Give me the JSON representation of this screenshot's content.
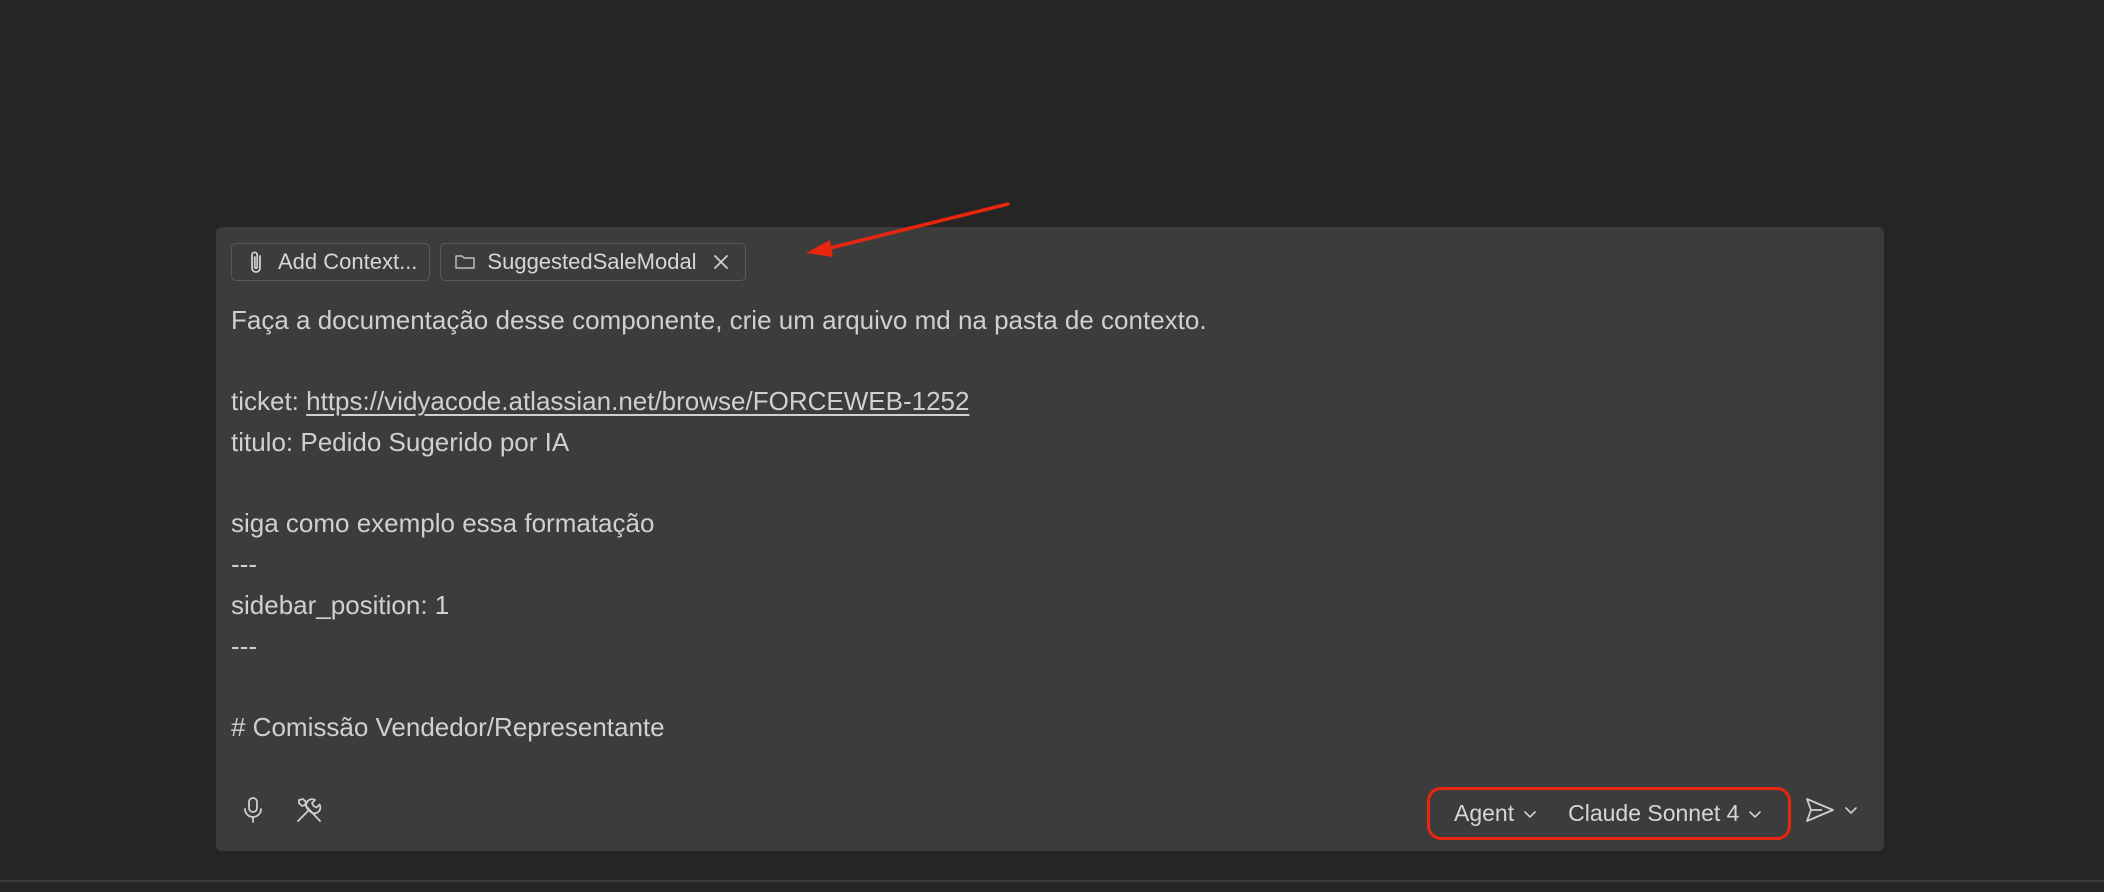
{
  "context_bar": {
    "add_context_label": "Add Context...",
    "attached_folder_label": "SuggestedSaleModal"
  },
  "message": {
    "line1": "Faça a documentação desse componente, crie um arquivo md na pasta de contexto.",
    "line2": "",
    "ticket_prefix": "ticket: ",
    "ticket_link": "https://vidyacode.atlassian.net/browse/FORCEWEB-1252",
    "line4": "titulo: Pedido Sugerido por IA",
    "line5": "",
    "line6": "siga como exemplo essa formatação",
    "line7": "---",
    "line8": "sidebar_position: 1",
    "line9": "---",
    "line10": "",
    "line11": "# Comissão Vendedor/Representante"
  },
  "toolbar": {
    "mode_label": "Agent",
    "model_label": "Claude Sonnet 4"
  },
  "colors": {
    "highlight": "#e8260f",
    "panel_bg": "#3c3c3c",
    "page_bg": "#252526"
  },
  "icons": [
    "paperclip-icon",
    "folder-icon",
    "close-icon",
    "microphone-icon",
    "tools-icon",
    "chevron-down-icon",
    "send-icon"
  ]
}
